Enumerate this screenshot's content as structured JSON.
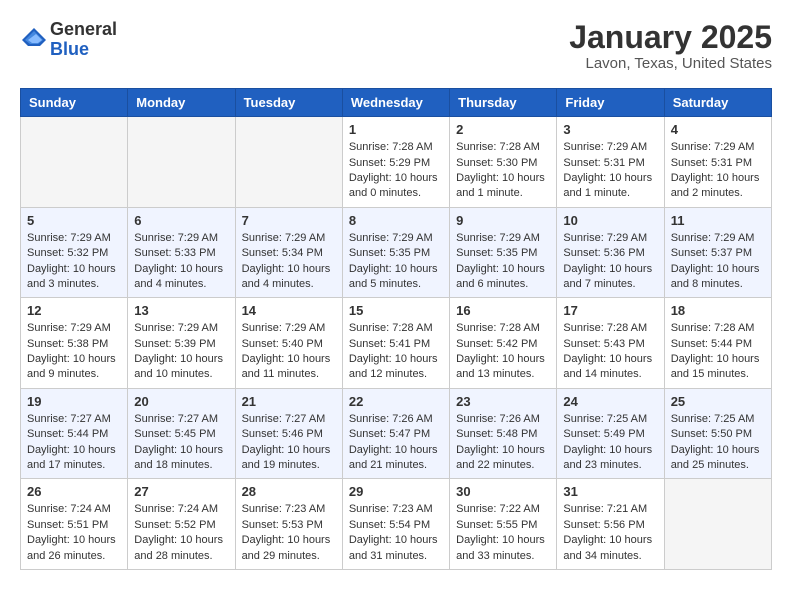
{
  "header": {
    "logo_line1": "General",
    "logo_line2": "Blue",
    "month": "January 2025",
    "location": "Lavon, Texas, United States"
  },
  "days_of_week": [
    "Sunday",
    "Monday",
    "Tuesday",
    "Wednesday",
    "Thursday",
    "Friday",
    "Saturday"
  ],
  "weeks": [
    {
      "days": [
        {
          "number": "",
          "empty": true
        },
        {
          "number": "",
          "empty": true
        },
        {
          "number": "",
          "empty": true
        },
        {
          "number": "1",
          "sunrise": "7:28 AM",
          "sunset": "5:29 PM",
          "daylight": "10 hours and 0 minutes."
        },
        {
          "number": "2",
          "sunrise": "7:28 AM",
          "sunset": "5:30 PM",
          "daylight": "10 hours and 1 minute."
        },
        {
          "number": "3",
          "sunrise": "7:29 AM",
          "sunset": "5:31 PM",
          "daylight": "10 hours and 1 minute."
        },
        {
          "number": "4",
          "sunrise": "7:29 AM",
          "sunset": "5:31 PM",
          "daylight": "10 hours and 2 minutes."
        }
      ]
    },
    {
      "days": [
        {
          "number": "5",
          "sunrise": "7:29 AM",
          "sunset": "5:32 PM",
          "daylight": "10 hours and 3 minutes."
        },
        {
          "number": "6",
          "sunrise": "7:29 AM",
          "sunset": "5:33 PM",
          "daylight": "10 hours and 4 minutes."
        },
        {
          "number": "7",
          "sunrise": "7:29 AM",
          "sunset": "5:34 PM",
          "daylight": "10 hours and 4 minutes."
        },
        {
          "number": "8",
          "sunrise": "7:29 AM",
          "sunset": "5:35 PM",
          "daylight": "10 hours and 5 minutes."
        },
        {
          "number": "9",
          "sunrise": "7:29 AM",
          "sunset": "5:35 PM",
          "daylight": "10 hours and 6 minutes."
        },
        {
          "number": "10",
          "sunrise": "7:29 AM",
          "sunset": "5:36 PM",
          "daylight": "10 hours and 7 minutes."
        },
        {
          "number": "11",
          "sunrise": "7:29 AM",
          "sunset": "5:37 PM",
          "daylight": "10 hours and 8 minutes."
        }
      ]
    },
    {
      "days": [
        {
          "number": "12",
          "sunrise": "7:29 AM",
          "sunset": "5:38 PM",
          "daylight": "10 hours and 9 minutes."
        },
        {
          "number": "13",
          "sunrise": "7:29 AM",
          "sunset": "5:39 PM",
          "daylight": "10 hours and 10 minutes."
        },
        {
          "number": "14",
          "sunrise": "7:29 AM",
          "sunset": "5:40 PM",
          "daylight": "10 hours and 11 minutes."
        },
        {
          "number": "15",
          "sunrise": "7:28 AM",
          "sunset": "5:41 PM",
          "daylight": "10 hours and 12 minutes."
        },
        {
          "number": "16",
          "sunrise": "7:28 AM",
          "sunset": "5:42 PM",
          "daylight": "10 hours and 13 minutes."
        },
        {
          "number": "17",
          "sunrise": "7:28 AM",
          "sunset": "5:43 PM",
          "daylight": "10 hours and 14 minutes."
        },
        {
          "number": "18",
          "sunrise": "7:28 AM",
          "sunset": "5:44 PM",
          "daylight": "10 hours and 15 minutes."
        }
      ]
    },
    {
      "days": [
        {
          "number": "19",
          "sunrise": "7:27 AM",
          "sunset": "5:44 PM",
          "daylight": "10 hours and 17 minutes."
        },
        {
          "number": "20",
          "sunrise": "7:27 AM",
          "sunset": "5:45 PM",
          "daylight": "10 hours and 18 minutes."
        },
        {
          "number": "21",
          "sunrise": "7:27 AM",
          "sunset": "5:46 PM",
          "daylight": "10 hours and 19 minutes."
        },
        {
          "number": "22",
          "sunrise": "7:26 AM",
          "sunset": "5:47 PM",
          "daylight": "10 hours and 21 minutes."
        },
        {
          "number": "23",
          "sunrise": "7:26 AM",
          "sunset": "5:48 PM",
          "daylight": "10 hours and 22 minutes."
        },
        {
          "number": "24",
          "sunrise": "7:25 AM",
          "sunset": "5:49 PM",
          "daylight": "10 hours and 23 minutes."
        },
        {
          "number": "25",
          "sunrise": "7:25 AM",
          "sunset": "5:50 PM",
          "daylight": "10 hours and 25 minutes."
        }
      ]
    },
    {
      "days": [
        {
          "number": "26",
          "sunrise": "7:24 AM",
          "sunset": "5:51 PM",
          "daylight": "10 hours and 26 minutes."
        },
        {
          "number": "27",
          "sunrise": "7:24 AM",
          "sunset": "5:52 PM",
          "daylight": "10 hours and 28 minutes."
        },
        {
          "number": "28",
          "sunrise": "7:23 AM",
          "sunset": "5:53 PM",
          "daylight": "10 hours and 29 minutes."
        },
        {
          "number": "29",
          "sunrise": "7:23 AM",
          "sunset": "5:54 PM",
          "daylight": "10 hours and 31 minutes."
        },
        {
          "number": "30",
          "sunrise": "7:22 AM",
          "sunset": "5:55 PM",
          "daylight": "10 hours and 33 minutes."
        },
        {
          "number": "31",
          "sunrise": "7:21 AM",
          "sunset": "5:56 PM",
          "daylight": "10 hours and 34 minutes."
        },
        {
          "number": "",
          "empty": true
        }
      ]
    }
  ]
}
